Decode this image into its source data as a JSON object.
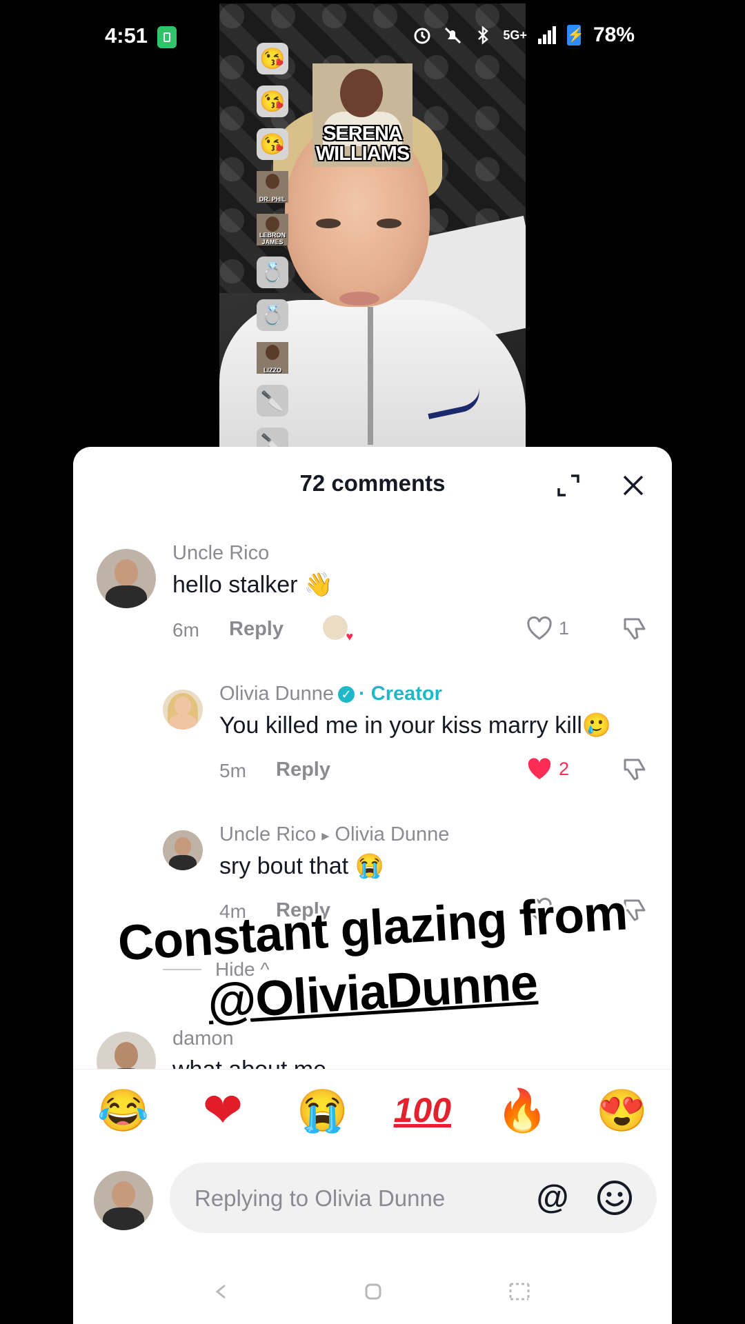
{
  "status_bar": {
    "time": "4:51",
    "battery": "78%",
    "network": "5G+"
  },
  "video": {
    "celebrity_cards": [
      {
        "text": "SERENA WILLIAMS"
      },
      {
        "text": "DR. PHIL"
      },
      {
        "text": "LEBRON JAMES"
      },
      {
        "text": "LIZZO"
      }
    ]
  },
  "comments_sheet": {
    "title": "72 comments",
    "comments": [
      {
        "user": "Uncle Rico",
        "text": "hello stalker 👋",
        "time": "6m",
        "reply_label": "Reply",
        "likes": "1"
      },
      {
        "user": "Olivia Dunne",
        "creator_label": "· Creator",
        "text": "You killed me in your kiss marry kill🥲",
        "time": "5m",
        "reply_label": "Reply",
        "likes": "2"
      },
      {
        "user": "Uncle Rico",
        "reply_to_arrow": "▸",
        "reply_to": "Olivia Dunne",
        "text": "sry bout that 😭",
        "time": "4m",
        "reply_label": "Reply"
      },
      {
        "user": "damon",
        "text": "what about me"
      }
    ],
    "hide_label": "Hide ^",
    "emoji_bar": [
      "😂",
      "❤",
      "😭",
      "100",
      "🔥",
      "😍"
    ],
    "composer": {
      "placeholder": "Replying to Olivia Dunne",
      "mention_symbol": "@"
    }
  },
  "overlay_caption": {
    "line1": "Constant glazing from",
    "line2": "@OliviaDunne"
  },
  "colors": {
    "accent_red": "#fe2c55",
    "creator_teal": "#20b8c6",
    "sheet_bg": "#ffffff",
    "text_primary": "#161823",
    "text_secondary": "#8a8b91"
  }
}
